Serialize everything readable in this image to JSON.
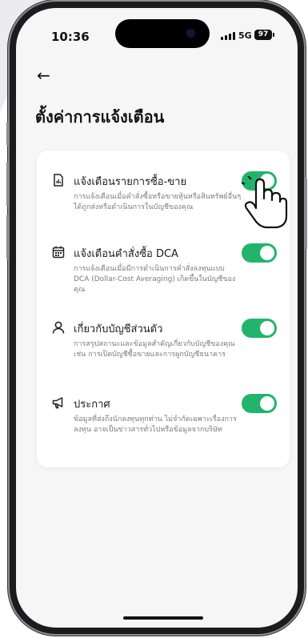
{
  "status": {
    "time": "10:36",
    "network": "5G",
    "battery": "97"
  },
  "header": {
    "back_icon": "←",
    "title": "ตั้งค่าการแจ้งเตือน"
  },
  "colors": {
    "accent": "#22b46c",
    "background": "#f6f6f7",
    "card": "#ffffff"
  },
  "settings": [
    {
      "icon": "receipt-icon",
      "title": "แจ้งเตือนรายการซื้อ-ขาย",
      "desc": "การแจ้งเตือนเมื่อคำสั่งซื้อหรือขายหุ้นหรือสินทรัพย์อื่นๆ ได้ถูกส่งหรือดำเนินการในบัญชีของคุณ",
      "enabled": true
    },
    {
      "icon": "calendar-icon",
      "title": "แจ้งเตือนคำสั่งซื้อ DCA",
      "desc": "การแจ้งเตือนเมื่อมีการดำเนินการคำสั่งลงทุนแบบ DCA (Dollar-Cost Averaging) เกิดขึ้นในบัญชีของคุณ",
      "enabled": true
    },
    {
      "icon": "user-icon",
      "title": "เกี่ยวกับบัญชีส่วนตัว",
      "desc": "การสรุปสถานะและข้อมูลสำคัญเกี่ยวกับบัญชีของคุณ เช่น การเปิดบัญชีซื้อขายและการผูกบัญชีธนาคาร",
      "enabled": true
    },
    {
      "icon": "megaphone-icon",
      "title": "ประกาศ",
      "desc": "ข้อมูลที่ส่งถึงนักลงทุนทุกท่าน ไม่จำกัดเฉพาะเรื่องการลงทุน อาจเป็นข่าวสารทั่วไปหรือข้อมูลจากบริษัท",
      "enabled": true
    }
  ]
}
